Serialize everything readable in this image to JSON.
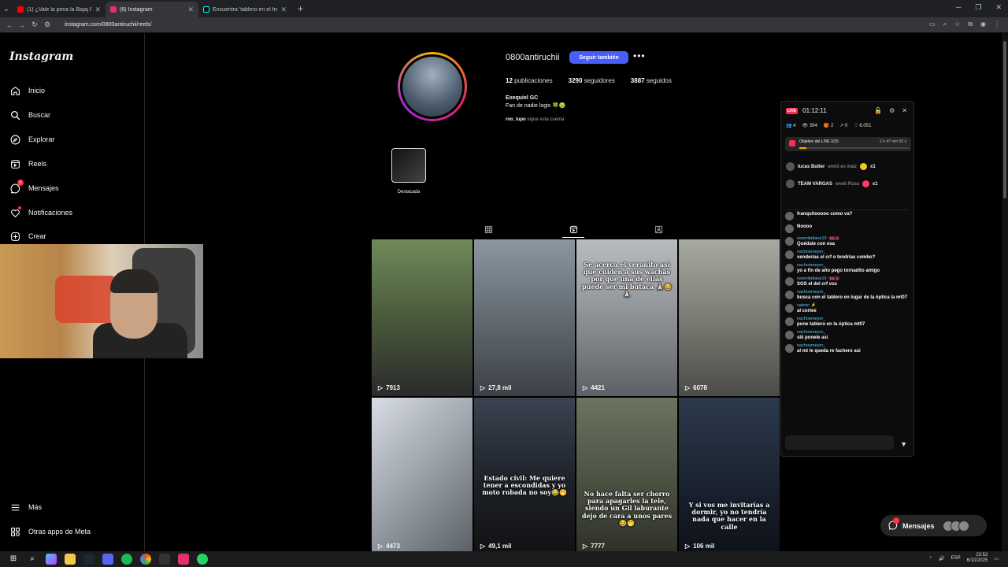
{
  "browser": {
    "tabs": [
      {
        "label": "(1) ¿Vale la pena la Bajaj Rouser",
        "color": "#ff0000",
        "active": false
      },
      {
        "label": "(6) Instagram",
        "color": "#e1306c",
        "active": true
      },
      {
        "label": "Encuentra 'tablero en el frente'",
        "color": "#111111",
        "active": false
      }
    ],
    "url": "instagram.com/0800antiruchii/reels/"
  },
  "sidebar": {
    "logo": "Instagram",
    "items": [
      {
        "label": "Inicio",
        "icon": "home-icon"
      },
      {
        "label": "Buscar",
        "icon": "search-icon"
      },
      {
        "label": "Explorar",
        "icon": "compass-icon"
      },
      {
        "label": "Reels",
        "icon": "reels-icon"
      },
      {
        "label": "Mensajes",
        "icon": "messenger-icon",
        "badge": "6"
      },
      {
        "label": "Notificaciones",
        "icon": "heart-icon"
      },
      {
        "label": "Crear",
        "icon": "plus-icon"
      },
      {
        "label": "Más",
        "icon": "menu-icon"
      },
      {
        "label": "Otras apps de Meta",
        "icon": "apps-icon"
      }
    ]
  },
  "profile": {
    "username": "0800antiruchii",
    "follow_label": "Seguir también",
    "posts_count": "12",
    "posts_label": "publicaciones",
    "followers_count": "3290",
    "followers_label": "seguidores",
    "following_count": "3887",
    "following_label": "seguidos",
    "full_name": "Exequiel GC",
    "bio": "Fan de nadie logis 🍀🤢",
    "followed_by_user": "roo_lupo",
    "followed_by_text": "sigue esta cuenta",
    "highlight_label": "Destacada"
  },
  "reels": [
    {
      "views": "7913",
      "caption": ""
    },
    {
      "views": "27,8 mil",
      "caption": ""
    },
    {
      "views": "4421",
      "caption": "Se acerca el veranito así que cuiden a sus wachas por que una de ellas puede ser mi butaca 🙏🏻😂🙏🏻"
    },
    {
      "views": "6078",
      "caption": ""
    },
    {
      "views": "4473",
      "caption": ""
    },
    {
      "views": "49,1 mil",
      "caption": "Estado civil: Me quiere tener a escondidas y yo moto robada no soy😂🤭"
    },
    {
      "views": "7777",
      "caption": "No hace falta ser chorro para apagarles la tele, siendo un Gil laburante dejo de cara a unos pares😂🤭"
    },
    {
      "views": "106 mil",
      "caption": "Y si vos me invitarías a dormir, yo no tendría nada que hacer en la calle"
    }
  ],
  "live": {
    "badge": "LIVE",
    "timer": "01:12:11",
    "stats": {
      "viewers": "4",
      "watching": "394",
      "gifts": "2",
      "shares": "0",
      "likes": "6.051"
    },
    "goal_label": "Objetivo del LIVE 1/15",
    "goal_time": "2 h 47 min 56 s",
    "goal_progress": 0.067,
    "gifts": [
      {
        "user": "lucas Butler",
        "text": "envió es maiz",
        "count": "x1",
        "color": "#f5c518"
      },
      {
        "user": "TEAM VARGAS",
        "text": "envió Rosa",
        "count": "x1",
        "color": "#ff3a6a"
      }
    ],
    "chat": [
      {
        "name": "",
        "text": "franquitooooo como va?",
        "badge": ""
      },
      {
        "name": "",
        "text": "Noooo",
        "badge": ""
      },
      {
        "name": "naomitatiana19",
        "text": "Quédate con esa",
        "badge": "No. 1"
      },
      {
        "name": "nachoomeyer_",
        "text": "venderías el crf o tendrías combo?",
        "badge": ""
      },
      {
        "name": "nachoomeyer_",
        "text": "yo a fin de año pego tornadito amigo",
        "badge": ""
      },
      {
        "name": "naomitatiana19",
        "text": "SOS el del crf vos",
        "badge": "No. 1"
      },
      {
        "name": "nachoomeyer_",
        "text": "busca con el tablero en lugar de la óptica la mt07",
        "badge": ""
      },
      {
        "name": "valenn ⚡",
        "text": "al cortee",
        "badge": ""
      },
      {
        "name": "nachoomeyer_",
        "text": "pone tablero en la óptica mt07",
        "badge": ""
      },
      {
        "name": "nachoomeyer_",
        "text": "siii ponele asi",
        "badge": ""
      },
      {
        "name": "nachoomeyer_",
        "text": "al mt le queda re fachero asi",
        "badge": ""
      }
    ]
  },
  "messages_pill": {
    "label": "Mensajes",
    "badge": "6"
  },
  "taskbar": {
    "lang": "ESP",
    "time": "23:52",
    "date": "6/10/2025"
  }
}
